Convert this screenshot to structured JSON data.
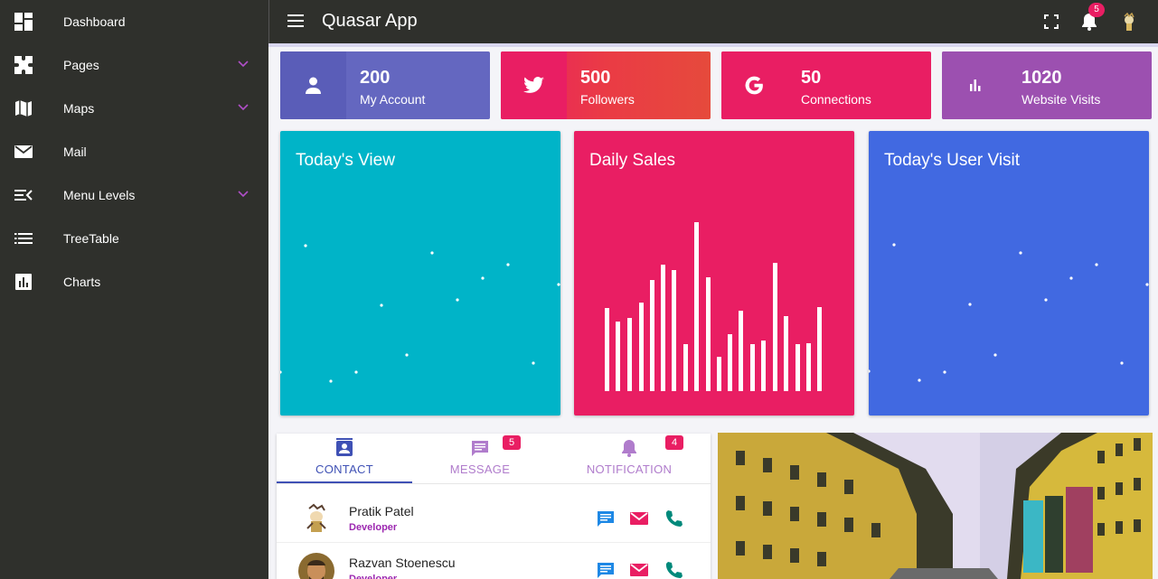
{
  "sidebar": {
    "items": [
      {
        "label": "Dashboard",
        "icon": "dashboard-icon",
        "expandable": false
      },
      {
        "label": "Pages",
        "icon": "pages-icon",
        "expandable": true
      },
      {
        "label": "Maps",
        "icon": "map-icon",
        "expandable": true
      },
      {
        "label": "Mail",
        "icon": "mail-icon",
        "expandable": false
      },
      {
        "label": "Menu Levels",
        "icon": "menu-open-icon",
        "expandable": true
      },
      {
        "label": "TreeTable",
        "icon": "list-icon",
        "expandable": false
      },
      {
        "label": "Charts",
        "icon": "chart-icon",
        "expandable": false
      }
    ]
  },
  "header": {
    "title": "Quasar App",
    "notification_count": "5"
  },
  "stats": [
    {
      "value": "200",
      "label": "My Account",
      "icon": "person-icon",
      "color": "#6467c0",
      "icon_bg": "#5558b5"
    },
    {
      "value": "500",
      "label": "Followers",
      "icon": "twitter-icon",
      "color": "#e64a3c",
      "icon_bg": "#e91e63"
    },
    {
      "value": "50",
      "label": "Connections",
      "icon": "google-icon",
      "color": "#e91e63",
      "icon_bg": "#e91e63"
    },
    {
      "value": "1020",
      "label": "Website Visits",
      "icon": "bar-chart-icon",
      "color": "#9c50b0",
      "icon_bg": "#9c50b0"
    }
  ],
  "cards": [
    {
      "title": "Today's View",
      "color": "#00b4c8"
    },
    {
      "title": "Daily Sales",
      "color": "#e91e63"
    },
    {
      "title": "Today's User Visit",
      "color": "#4169e1"
    }
  ],
  "chart_data": [
    {
      "type": "scatter",
      "title": "Today's View"
    },
    {
      "type": "bar",
      "title": "Daily Sales"
    },
    {
      "type": "scatter",
      "title": "Today's User Visit"
    }
  ],
  "tabs": [
    {
      "label": "CONTACT",
      "icon": "contact-icon",
      "badge": "",
      "active": true
    },
    {
      "label": "MESSAGE",
      "icon": "message-icon",
      "badge": "5",
      "active": false
    },
    {
      "label": "NOTIFICATION",
      "icon": "bell-icon",
      "badge": "4",
      "active": false
    }
  ],
  "contacts": [
    {
      "name": "Pratik Patel",
      "role": "Developer"
    },
    {
      "name": "Razvan Stoenescu",
      "role": "Developer"
    }
  ],
  "colors": {
    "sidebar_bg": "#2f302c",
    "accent_purple": "#9c27b0",
    "tab_active": "#3f51b5",
    "action_message": "#1e88e5",
    "action_mail": "#e91e63",
    "action_call": "#00897b"
  }
}
